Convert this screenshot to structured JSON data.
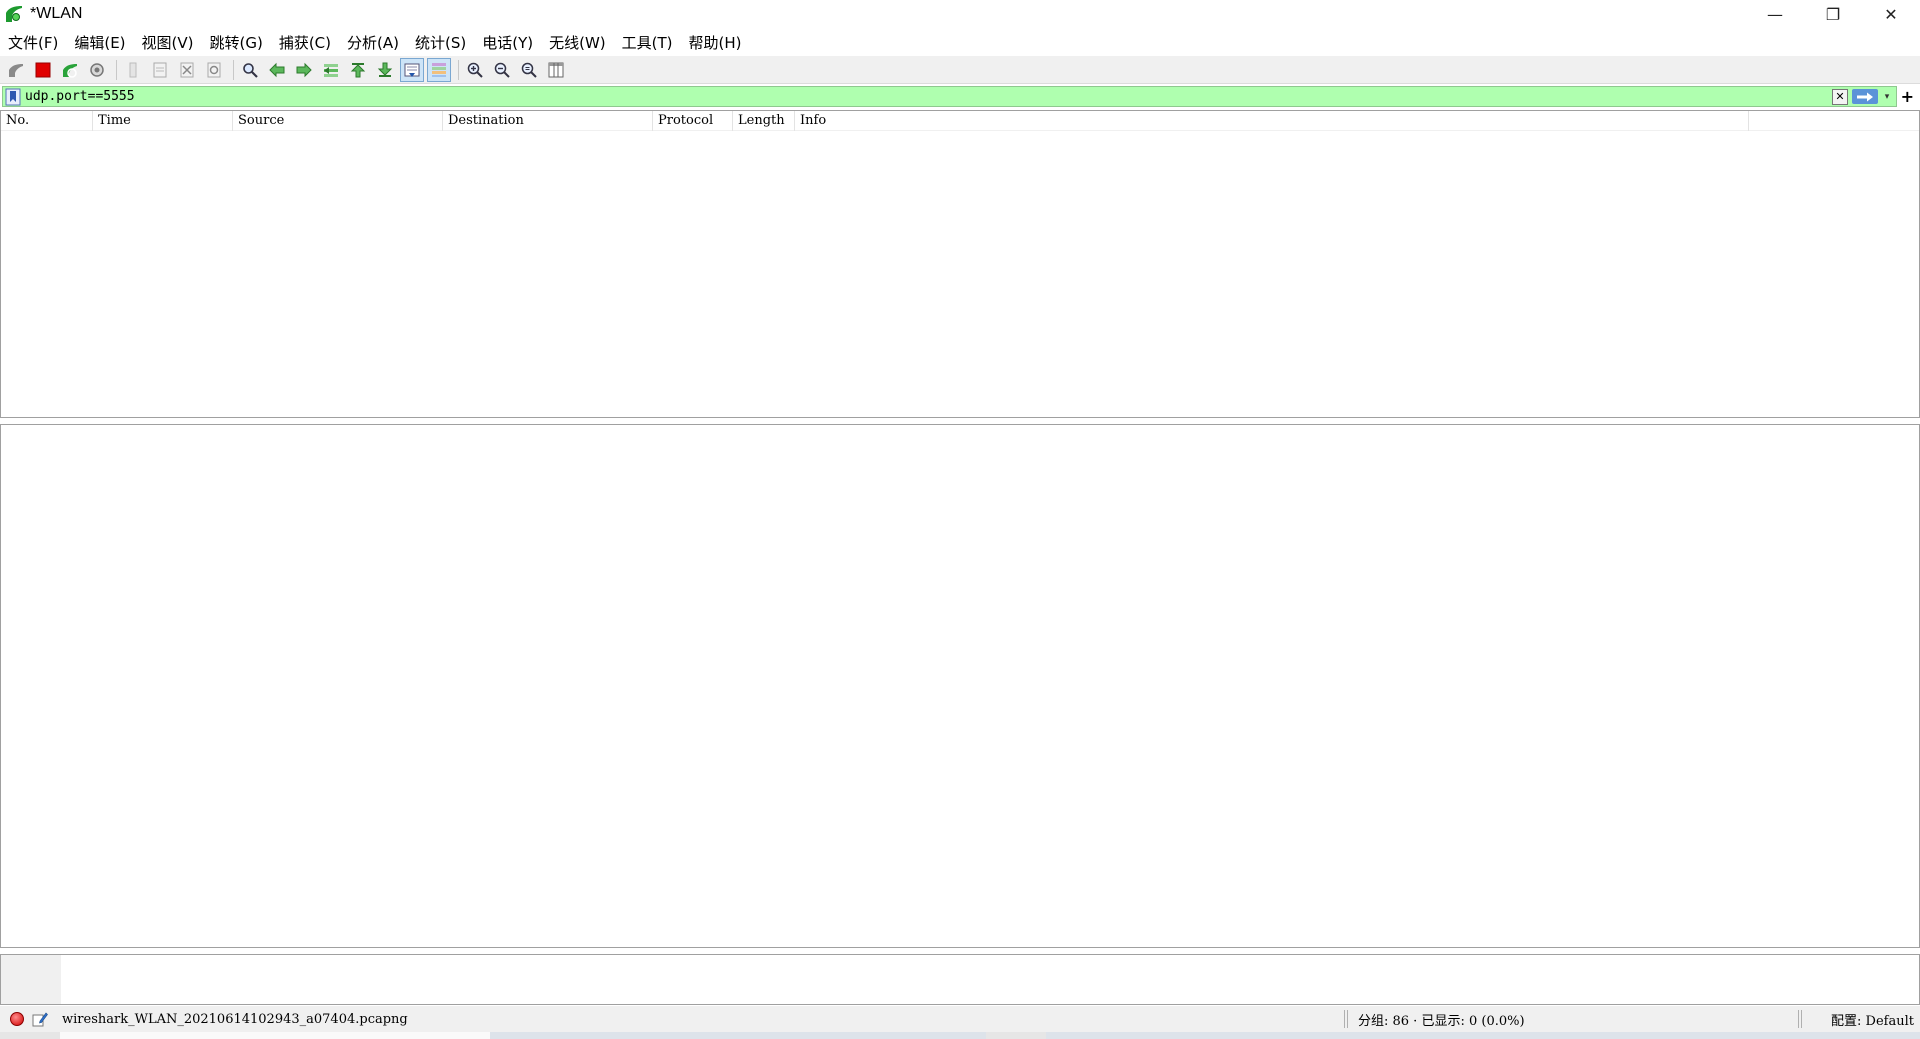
{
  "window": {
    "title": "*WLAN",
    "minimize_glyph": "—",
    "restore_glyph": "❐",
    "close_glyph": "✕"
  },
  "menu": [
    {
      "label": "文件(F)"
    },
    {
      "label": "编辑(E)"
    },
    {
      "label": "视图(V)"
    },
    {
      "label": "跳转(G)"
    },
    {
      "label": "捕获(C)"
    },
    {
      "label": "分析(A)"
    },
    {
      "label": "统计(S)"
    },
    {
      "label": "电话(Y)"
    },
    {
      "label": "无线(W)"
    },
    {
      "label": "工具(T)"
    },
    {
      "label": "帮助(H)"
    }
  ],
  "toolbar": {
    "icons": [
      "start-capture-icon",
      "stop-capture-icon",
      "restart-capture-icon",
      "capture-options-icon",
      "open-file-icon",
      "save-file-icon",
      "close-file-icon",
      "reload-file-icon",
      "find-packet-icon",
      "go-back-icon",
      "go-forward-icon",
      "go-to-packet-icon",
      "go-first-icon",
      "go-last-icon",
      "auto-scroll-icon",
      "colorize-icon",
      "zoom-in-icon",
      "zoom-out-icon",
      "zoom-normal-icon",
      "resize-columns-icon"
    ]
  },
  "filter": {
    "value": "udp.port==5555",
    "background_color": "#afffaf",
    "add_label": "+"
  },
  "packet_list": {
    "columns": [
      "No.",
      "Time",
      "Source",
      "Destination",
      "Protocol",
      "Length",
      "Info"
    ]
  },
  "status": {
    "filename": "wireshark_WLAN_20210614102943_a07404.pcapng",
    "packets": "分组: 86 · 已显示: 0 (0.0%)",
    "profile": "配置: Default"
  }
}
